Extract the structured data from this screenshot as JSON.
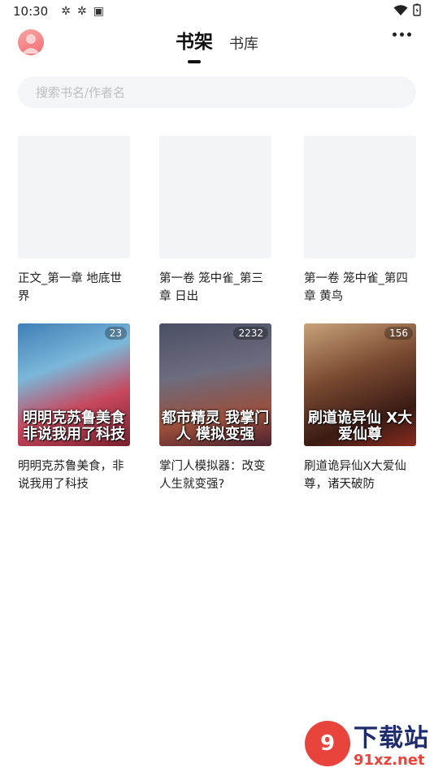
{
  "status_bar": {
    "time": "10:30"
  },
  "header": {
    "tabs": [
      {
        "label": "书架",
        "active": true
      },
      {
        "label": "书库",
        "active": false
      }
    ]
  },
  "search": {
    "placeholder": "搜索书名/作者名"
  },
  "books": [
    {
      "title": "正文_第一章 地底世界",
      "badge": "",
      "cover_text": ""
    },
    {
      "title": "第一卷 笼中雀_第三章 日出",
      "badge": "",
      "cover_text": ""
    },
    {
      "title": "第一卷 笼中雀_第四章 黄鸟",
      "badge": "",
      "cover_text": ""
    },
    {
      "title": "明明克苏鲁美食，非说我用了科技",
      "badge": "23",
      "cover_text": "明明克苏鲁美食 非说我用了科技"
    },
    {
      "title": "掌门人模拟器：改变人生就变强?",
      "badge": "2232",
      "cover_text": "都市精灵 我掌门人 模拟变强"
    },
    {
      "title": "刷道诡异仙X大爱仙尊，诸天破防",
      "badge": "156",
      "cover_text": "刷道诡异仙 X大爱仙尊"
    }
  ],
  "watermark": {
    "logo_text": "9",
    "big_text": "下载站",
    "url_text": "91xz.net"
  },
  "colors": {
    "avatar": "#f16c71",
    "search_bg": "#f4f5f8",
    "cover_placeholder": "#f3f4f7",
    "watermark_red": "#e8433d",
    "watermark_blue": "#1f2b6f"
  }
}
